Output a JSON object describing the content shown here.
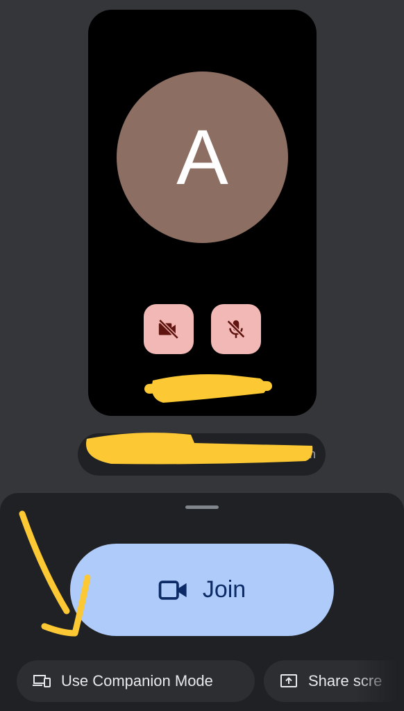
{
  "preview": {
    "avatar_initial": "A",
    "camera_toggle_icon": "video-off-icon",
    "mic_toggle_icon": "mic-off-icon"
  },
  "account": {
    "visible_fragment": "m"
  },
  "sheet": {
    "join": {
      "label": "Join",
      "icon": "video-camera-icon"
    },
    "companion_mode": {
      "label": "Use Companion Mode",
      "icon": "companion-devices-icon"
    },
    "share_screen": {
      "label": "Share scre",
      "icon": "share-screen-icon"
    }
  },
  "colors": {
    "background": "#35363a",
    "avatar": "#8c6e63",
    "toggle_off": "#f2b8b5",
    "join_button": "#aecbfa",
    "sheet": "#202124",
    "annotation": "#fcc934"
  }
}
